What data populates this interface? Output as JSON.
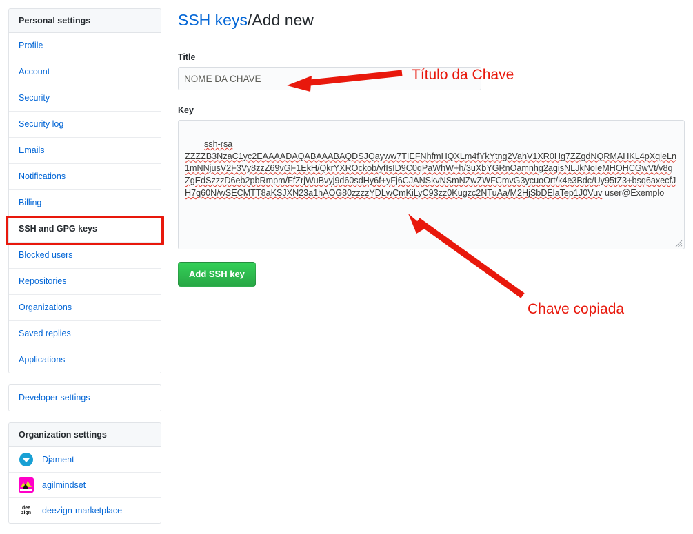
{
  "sidebar": {
    "personal": {
      "header": "Personal settings",
      "items": [
        {
          "label": "Profile",
          "name": "profile"
        },
        {
          "label": "Account",
          "name": "account"
        },
        {
          "label": "Security",
          "name": "security"
        },
        {
          "label": "Security log",
          "name": "security-log"
        },
        {
          "label": "Emails",
          "name": "emails"
        },
        {
          "label": "Notifications",
          "name": "notifications"
        },
        {
          "label": "Billing",
          "name": "billing"
        },
        {
          "label": "SSH and GPG keys",
          "name": "ssh-and-gpg-keys",
          "selected": true
        },
        {
          "label": "Blocked users",
          "name": "blocked-users"
        },
        {
          "label": "Repositories",
          "name": "repositories"
        },
        {
          "label": "Organizations",
          "name": "organizations"
        },
        {
          "label": "Saved replies",
          "name": "saved-replies"
        },
        {
          "label": "Applications",
          "name": "applications"
        }
      ]
    },
    "developer": {
      "label": "Developer settings"
    },
    "organizations": {
      "header": "Organization settings",
      "items": [
        {
          "label": "Djament",
          "avatar": "djament-avatar"
        },
        {
          "label": "agilmindset",
          "avatar": "agilmindset-avatar"
        },
        {
          "label": "deezign-marketplace",
          "avatar": "deezign-avatar",
          "avatar_text_top": "dee",
          "avatar_text_bottom": "zign"
        }
      ]
    }
  },
  "main": {
    "breadcrumb_link": "SSH keys",
    "breadcrumb_separator": "/",
    "breadcrumb_current": "Add new",
    "title_label": "Title",
    "title_value": "NOME DA CHAVE",
    "title_placeholder": "",
    "key_label": "Key",
    "key_prefix": "ssh-rsa",
    "key_body": "ZZZZB3NzaC1yc2EAAAADAQABAAABAQDSJQayww7TIEFNhfmHQXLm4fYkYtng2VahV1XR0Hg7ZZgdNQRMAHKL4pXqieLn1mNNjusV2F3Vy8zzZ69vGF1EkH/QkrYXROckob/yfIsID9C0qPaWhW+h/3uXbYGRnOamnhg2aqisNLJkNoIeMHOHCGwVt/v8qZgEdSzzzD6eb2pbRmpm/FfZrjWuBvyj9d60sdHy6f+yFj6CJANSkvNSmNZwZWFCmvG3ycuoOrt/k4e3Bdc/Uy95tZ3+bsq6axecfJH7q60N/wSECMTT8aKSJXN23a1hAOG80zzzzYDLwCmKiLyC93zz0Kugzc2NTuAa/M2HjSbDElaTep1J0Vuv",
    "key_comment": "user@Exemplo",
    "key_placeholder": "",
    "submit_label": "Add SSH key"
  },
  "annotations": {
    "title_note": "Título da Chave",
    "key_note": "Chave copiada",
    "accent_color": "#e8180c"
  }
}
